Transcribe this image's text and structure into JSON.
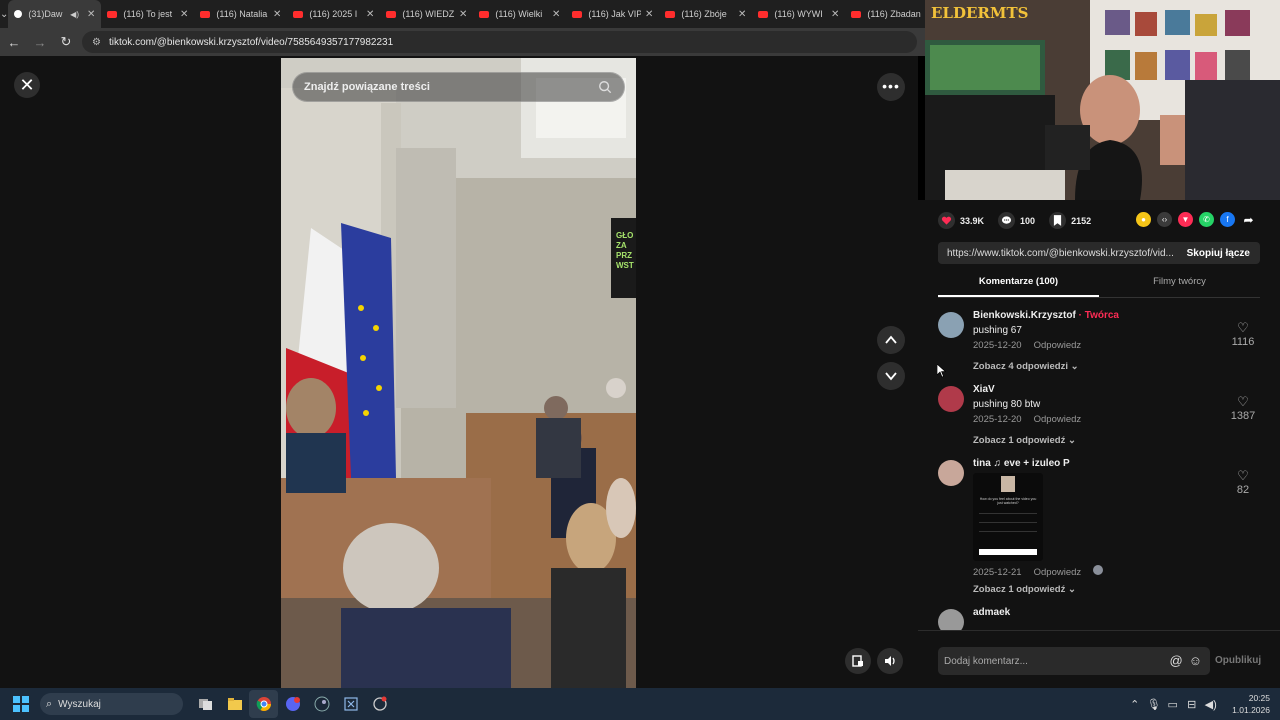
{
  "tabs": [
    {
      "label": "(31)Daw",
      "active": true,
      "favicon": "tiktok"
    },
    {
      "label": "(116) To jest",
      "favicon": "youtube"
    },
    {
      "label": "(116) Natalia",
      "favicon": "youtube"
    },
    {
      "label": "(116) 2025 I",
      "favicon": "youtube"
    },
    {
      "label": "(116) WIEDZ",
      "favicon": "youtube"
    },
    {
      "label": "(116) Wielki",
      "favicon": "youtube"
    },
    {
      "label": "(116) Jak VIP",
      "favicon": "youtube"
    },
    {
      "label": "(116) Zbóje",
      "favicon": "youtube"
    },
    {
      "label": "(116) WYWI",
      "favicon": "youtube"
    },
    {
      "label": "(116) Zbadan",
      "favicon": "youtube"
    }
  ],
  "address_bar": {
    "url": "tiktok.com/@bienkowski.krzysztof/video/7585649357177982231"
  },
  "player": {
    "search_placeholder": "Znajdź powiązane treści",
    "video_overlay_text": [
      "GŁO",
      "ZA",
      "PRZ",
      "WST"
    ]
  },
  "webcam": {
    "logo_text": "ELDERMTS"
  },
  "stats": {
    "likes": "33.9K",
    "comments": "100",
    "saves": "2152"
  },
  "share_icons": [
    "coin-icon",
    "embed-icon",
    "send-icon",
    "whatsapp-icon",
    "facebook-icon",
    "share-arrow-icon"
  ],
  "link": {
    "url": "https://www.tiktok.com/@bienkowski.krzysztof/vid...",
    "copy_label": "Skopiuj łącze"
  },
  "panel_tabs": [
    {
      "label": "Komentarze (100)",
      "active": true
    },
    {
      "label": "Filmy twórcy",
      "active": false
    }
  ],
  "comments": [
    {
      "author": "Bienkowski.Krzysztof",
      "creator_tag": "· Twórca",
      "text": "pushing 67",
      "date": "2025-12-20",
      "reply": "Odpowiedz",
      "likes": "1116",
      "replies": "Zobacz 4 odpowiedzi"
    },
    {
      "author": "XiaV",
      "text": "pushing 80 btw",
      "date": "2025-12-20",
      "reply": "Odpowiedz",
      "likes": "1387",
      "replies": "Zobacz 1 odpowiedź"
    },
    {
      "author": "tina ♫ eve + izuleo P",
      "text": "",
      "date": "2025-12-21",
      "reply": "Odpowiedz",
      "likes": "82",
      "replies": "Zobacz 1 odpowiedź",
      "sticker_text": "How do you feel about the video you just watched?"
    },
    {
      "author": "admaek"
    }
  ],
  "add_comment": {
    "placeholder": "Dodaj komentarz...",
    "publish_label": "Opublikuj"
  },
  "taskbar": {
    "search_label": "Wyszukaj",
    "time": "20:25",
    "date": "1.01.2026"
  },
  "colors": {
    "accent": "#fe2c55",
    "bg": "#121212",
    "taskbar": "#1c2a3a"
  }
}
